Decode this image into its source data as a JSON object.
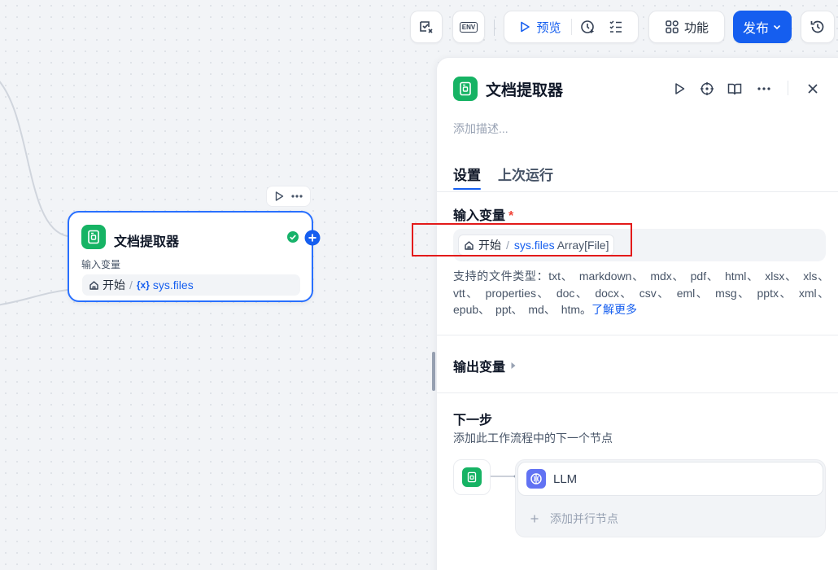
{
  "toolbar": {
    "preview_label": "预览",
    "features_label": "功能",
    "publish_label": "发布",
    "env_icon_text": "ENV"
  },
  "node": {
    "title": "文档提取器",
    "input_label": "输入变量",
    "var_source": "开始",
    "var_separator": "/",
    "var_prefix": "{x}",
    "var_name": "sys.files"
  },
  "panel": {
    "title": "文档提取器",
    "description_placeholder": "添加描述...",
    "tabs": [
      {
        "label": "设置",
        "active": true
      },
      {
        "label": "上次运行",
        "active": false
      }
    ],
    "input_section": {
      "title": "输入变量",
      "required_mark": "*",
      "var_source": "开始",
      "var_separator": "/",
      "var_name": "sys.files",
      "var_type": "Array[File]"
    },
    "file_types_text": "支持的文件类型：txt、 markdown、 mdx、 pdf、 html、 xlsx、 xls、 vtt、 properties、 doc、 docx、 csv、 eml、 msg、 pptx、 xml、 epub、 ppt、 md、 htm。",
    "learn_more": "了解更多",
    "output_section": {
      "title": "输出变量"
    },
    "next_step": {
      "title": "下一步",
      "subtitle": "添加此工作流程中的下一个节点",
      "next_node": "LLM",
      "add_parallel": "添加并行节点"
    }
  },
  "colors": {
    "accent": "#155eef",
    "node_green": "#16b364",
    "llm_purple": "#6172f3",
    "highlight_red": "#e31a1a",
    "success_green": "#17b26a"
  }
}
